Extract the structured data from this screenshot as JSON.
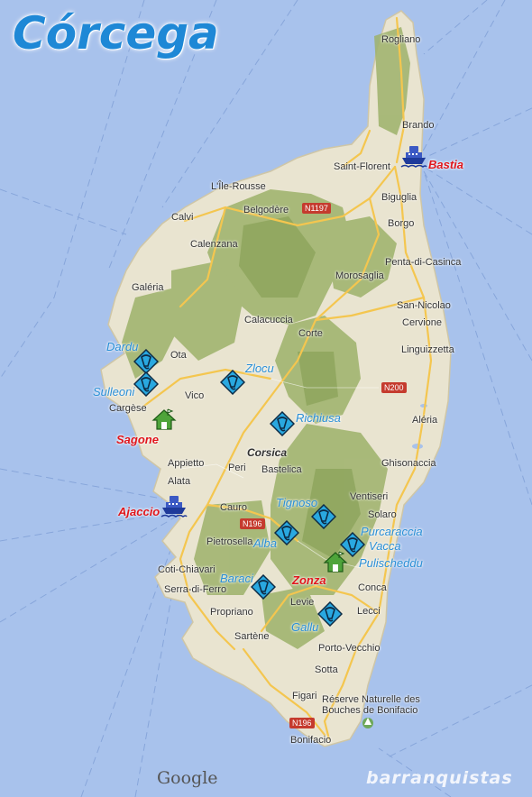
{
  "title": "Córcega",
  "towns": {
    "rogliano": "Rogliano",
    "brando": "Brando",
    "saint_florent": "Saint-Florent",
    "lile_rousse": "L'Île-Rousse",
    "biguglia": "Biguglia",
    "calvi": "Calvi",
    "belgodere": "Belgodère",
    "borgo": "Borgo",
    "calenzana": "Calenzana",
    "penta": "Penta-di-Casinca",
    "morosaglia": "Morosaglia",
    "galeria": "Galéria",
    "san_nicolao": "San-Nicolao",
    "calacuccia": "Calacuccia",
    "cervione": "Cervione",
    "corte": "Corte",
    "linguizzetta": "Linguizzetta",
    "ota": "Ota",
    "vico": "Vico",
    "cargese": "Cargèse",
    "aleria": "Aléria",
    "corsica": "Corsica",
    "ghisonaccia": "Ghisonaccia",
    "appietto": "Appietto",
    "peri": "Peri",
    "bastelica": "Bastelica",
    "alata": "Alata",
    "ventiseri": "Ventiseri",
    "cauro": "Cauro",
    "solaro": "Solaro",
    "pietrosella": "Pietrosella",
    "coti": "Coti-Chiavari",
    "serra": "Serra-di-Ferro",
    "conca": "Conca",
    "levie": "Levie",
    "propriano": "Propriano",
    "lecci": "Lecci",
    "sartene": "Sartène",
    "porto_vecchio": "Porto-Vecchio",
    "sotta": "Sotta",
    "figari": "Figari",
    "reserve": "Réserve Naturelle des",
    "bouches": "Bouches de Bonifacio",
    "bonifacio": "Bonifacio"
  },
  "roads": {
    "n1197": "N1197",
    "n200": "N200",
    "n196a": "N196",
    "n196b": "N196"
  },
  "canyons": {
    "dardu": "Dardu",
    "sulleoni": "Sulleoni",
    "zlocu": "Zlocu",
    "richiusa": "Richiusa",
    "tignoso": "Tignoso",
    "purcaraccia": "Purcaraccia",
    "vacca": "Vacca",
    "pulischeddu": "Pulischeddu",
    "alba": "Alba",
    "baraci": "Baraci",
    "gallu": "Gallu"
  },
  "ports": {
    "bastia": "Bastia",
    "ajaccio": "Ajaccio"
  },
  "bases": {
    "sagone": "Sagone",
    "zonza": "Zonza"
  },
  "attribution": {
    "google": "Google",
    "brand": "barranquistas"
  },
  "colors": {
    "sea": "#a8c2ec",
    "land": "#eae6d6",
    "relief": "#9fb26a",
    "canyon_marker": "#29a8e0",
    "canyon_label": "#2a8fd6",
    "highlight_label": "#e0161c",
    "road": "#f2c14e"
  }
}
